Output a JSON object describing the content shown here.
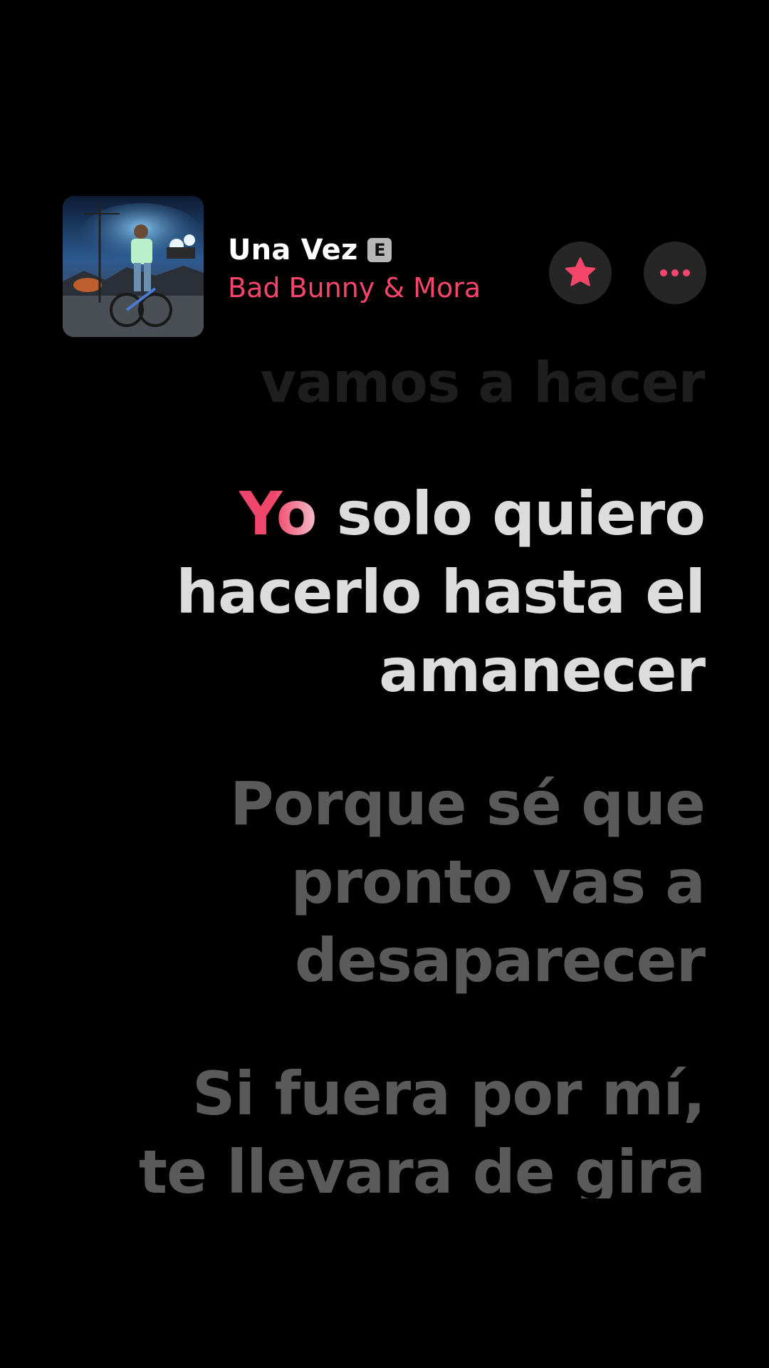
{
  "track": {
    "title": "Una Vez",
    "explicit_label": "E",
    "artist": "Bad Bunny & Mora"
  },
  "buttons": {
    "favorite_icon": "star-icon",
    "more_icon": "more-icon"
  },
  "lyrics": {
    "previous_line": "vamos a hacer",
    "current": {
      "active_word": "Yo",
      "line1_rest": " solo quiero",
      "line2": "hacerlo hasta el",
      "line3": "amanecer"
    },
    "next": {
      "line1": "Porque sé que",
      "line2": "pronto vas a",
      "line3": "desaparecer"
    },
    "later": {
      "line1": "Si fuera por mí,",
      "line2": "te llevara de gira"
    }
  },
  "colors": {
    "accent": "#F5456A",
    "background": "#000000",
    "current_text": "#DCDCDC",
    "upcoming_text": "#5A5A5A"
  }
}
